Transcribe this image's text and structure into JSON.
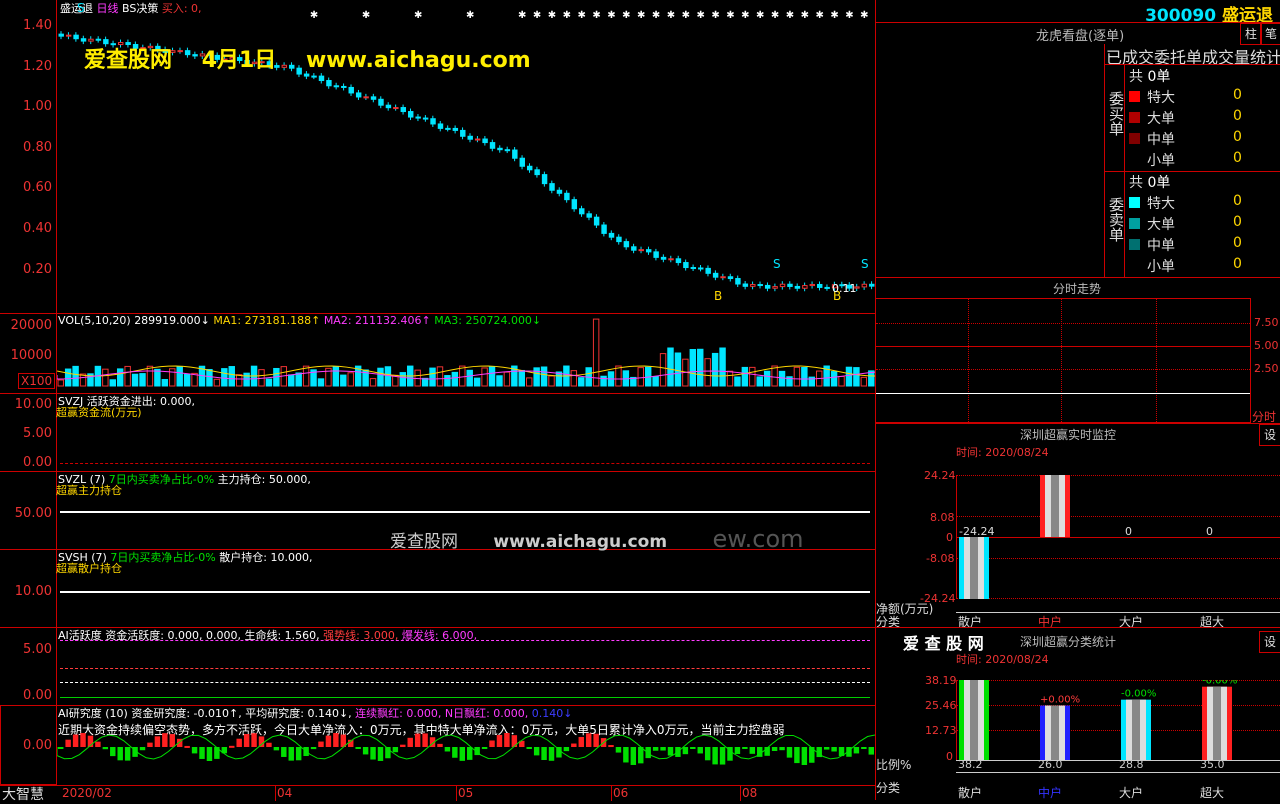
{
  "app": {
    "stock_code": "300090",
    "stock_name": "盛运退",
    "watermark_top": {
      "site": "爱查股网",
      "date": "4月1日",
      "url": "www.aichagu.com"
    },
    "watermark_mid": {
      "site": "爱查股网",
      "url": "www.aichagu.com",
      "tail": "ew.com"
    },
    "bottom_left_label": "大智慧"
  },
  "main_chart": {
    "header": {
      "name": "盛运退",
      "period": "日线",
      "indicator": "BS决策",
      "buy_label": "买入: 0,"
    },
    "y_ticks": [
      "1.40",
      "1.20",
      "1.00",
      "0.80",
      "0.60",
      "0.40",
      "0.20"
    ],
    "price_label": "0.11",
    "signals": [
      "S",
      "B",
      "S",
      "B",
      "S"
    ]
  },
  "vol_panel": {
    "header": {
      "name": "VOL(5,10,20)",
      "vol": "289919.000↓",
      "ma1": "MA1: 273181.188↑",
      "ma2": "MA2: 211132.406↑",
      "ma3": "MA3: 250724.000↓"
    },
    "y_ticks": [
      "20000",
      "10000"
    ],
    "unit": "X100"
  },
  "svzj_panel": {
    "header": {
      "name": "SVZJ",
      "desc": "活跃资金进出: 0.000,"
    },
    "subtitle": "超赢资金流(万元)",
    "y_ticks": [
      "10.00",
      "5.00",
      "0.00"
    ]
  },
  "svzl_panel": {
    "header": {
      "name": "SVZL (7)",
      "desc": "7日内买卖净占比-0%",
      "value": "主力持仓: 50.000,"
    },
    "subtitle": "超赢主力持仓",
    "y_ticks": [
      "50.00"
    ]
  },
  "svsh_panel": {
    "header": {
      "name": "SVSH (7)",
      "desc": "7日内买卖净占比-0%",
      "value": "散户持仓: 10.000,"
    },
    "subtitle": "超赢散户持仓",
    "y_ticks": [
      "10.00"
    ]
  },
  "ai_active_panel": {
    "header": {
      "name": "AI活跃度",
      "a": "资金活跃度: 0.000, 0.000,",
      "b": "生命线: 1.560,",
      "c": "强势线: 3.000,",
      "d": "爆发线: 6.000,"
    },
    "y_ticks": [
      "5.00",
      "0.00"
    ]
  },
  "ai_research_panel": {
    "header": {
      "name": "AI研究度 (10)",
      "a": "资金研究度: -0.010↑,",
      "b": "平均研究度: 0.140↓,",
      "c": "连续飘红: 0.000,",
      "d": "N日飘红: 0.000,",
      "e": "0.140↓"
    },
    "comment": "近期大资金持续偏空态势，多方不活跃，今日大单净流入：0万元，其中特大单净流入：0万元，大单5日累计净入0万元，当前主力控盘弱",
    "y_ticks": [
      "0.00"
    ]
  },
  "x_axis": {
    "labels": [
      "2020/02",
      "04",
      "05",
      "06",
      "08"
    ]
  },
  "right_panel": {
    "buttons": {
      "pillar": "柱",
      "pen": "笔",
      "settings1": "设",
      "settings2": "设"
    },
    "lhb": {
      "title": "龙虎看盘(逐单)",
      "subtitle": "已成交委托单成交量统计",
      "buy_label": "委买单",
      "sell_label": "委卖单",
      "buy": {
        "total_label": "共",
        "total": "0单",
        "rows": [
          {
            "label": "特大",
            "value": "0",
            "color": "#ff0000"
          },
          {
            "label": "大单",
            "value": "0",
            "color": "#b00000"
          },
          {
            "label": "中单",
            "value": "0",
            "color": "#800000"
          },
          {
            "label": "小单",
            "value": "0",
            "color": "#000000"
          }
        ]
      },
      "sell": {
        "total_label": "共",
        "total": "0单",
        "rows": [
          {
            "label": "特大",
            "value": "0",
            "color": "#00ffff"
          },
          {
            "label": "大单",
            "value": "0",
            "color": "#00a0a0"
          },
          {
            "label": "中单",
            "value": "0",
            "color": "#007070"
          },
          {
            "label": "小单",
            "value": "0",
            "color": "#000000"
          }
        ]
      }
    },
    "intraday": {
      "title": "分时走势",
      "ticks": [
        "7.50",
        "5.00",
        "2.50"
      ],
      "x_label": "分时"
    },
    "monitor": {
      "title": "深圳超赢实时监控",
      "time": "时间: 2020/08/24",
      "y_ticks": [
        "24.24",
        "8.08",
        "0",
        "-8.08",
        "-24.24"
      ],
      "bar_labels": [
        "-24.24",
        "24.24",
        "0",
        "0"
      ],
      "y_title": "净额(万元)",
      "x_title": "分类",
      "categories": [
        "散户",
        "中户",
        "大户",
        "超大"
      ],
      "chart_data": {
        "type": "bar",
        "categories": [
          "散户",
          "中户",
          "大户",
          "超大"
        ],
        "values": [
          -24.24,
          24.24,
          0,
          0
        ],
        "ylabel": "净额(万元)",
        "xlabel": "分类",
        "ylim": [
          -24.24,
          24.24
        ]
      }
    },
    "classify": {
      "logo": "爱 查 股 网",
      "title": "深圳超赢分类统计",
      "time": "时间: 2020/08/24",
      "y_ticks": [
        "38.19",
        "25.46",
        "12.73",
        "0"
      ],
      "top_labels": [
        "+0.00%",
        "-0.00%",
        "-0.00%"
      ],
      "bottom_values": [
        "38.2",
        "26.0",
        "28.8",
        "35.0"
      ],
      "y_title": "比例%",
      "x_title": "分类",
      "categories": [
        "散户",
        "中户",
        "大户",
        "超大"
      ],
      "chart_data": {
        "type": "bar",
        "categories": [
          "散户",
          "中户",
          "大户",
          "超大"
        ],
        "values": [
          38.2,
          26.0,
          28.8,
          35.0
        ],
        "ylabel": "比例%",
        "xlabel": "分类",
        "ylim": [
          0,
          38.19
        ]
      }
    }
  }
}
